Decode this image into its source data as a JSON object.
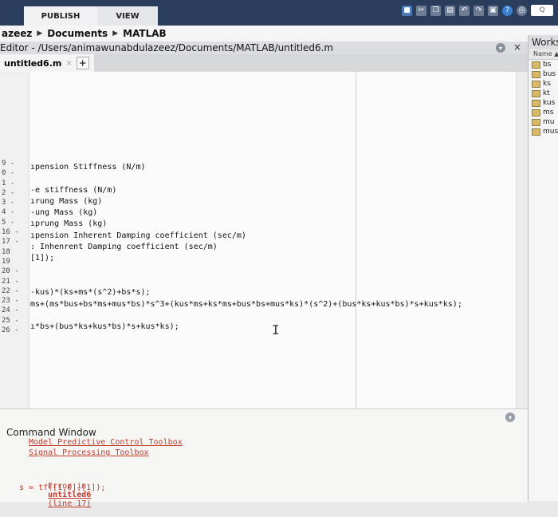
{
  "toolstrip": {
    "tabs": [
      "PUBLISH",
      "VIEW"
    ],
    "search_label": "Q"
  },
  "breadcrumb": [
    "azeez",
    "Documents",
    "MATLAB"
  ],
  "editor": {
    "title": "Editor - /Users/animawunabdulazeez/Documents/MATLAB/untitled6.m",
    "file_tab": "untitled6.m",
    "close_glyph": "×",
    "add_glyph": "+",
    "line_numbers": [
      "9 -",
      "0 -",
      "1 -",
      "2 -",
      "3 -",
      "4 -",
      "5 -",
      "16 -",
      "17 -",
      "18",
      "19",
      "20 -",
      "21 -",
      "22 -",
      "23 -",
      "24 -",
      "25 -",
      "26 -"
    ],
    "code_lines": [
      "ıpension Stiffness (N/m)",
      "",
      "-e stiffness (N/m)",
      "ırung Mass (kg)",
      "-ung Mass (kg)",
      "ıprung Mass (kg)",
      "ıpension Inherent Damping coefficient (sec/m)",
      ": Inhenrent Damping coefficient (sec/m)",
      "[1]);",
      "",
      "",
      "-kus)*(ks+ms*(s^2)+bs*s);",
      "ms+(ms*bus+bs*ms+mus*bs)*s^3+(kus*ms+ks*ms+bus*bs+mus*ks)*(s^2)+(bus*ks+kus*bs)*s+kus*ks);",
      "",
      "ı*bs+(bus*ks+kus*bs)*s+kus*ks);",
      "",
      "",
      ""
    ],
    "text_cursor": "I"
  },
  "command_window": {
    "title": "Command Window",
    "links": [
      "Model Predictive Control Toolbox",
      "Signal Processing Toolbox"
    ],
    "error_prefix": "Error in",
    "error_file": "untitled6",
    "error_line": "(line 17)",
    "error_code": "s = tf([1,0],[1]);"
  },
  "workspace": {
    "title": "Works",
    "column": "Name ▲",
    "variables": [
      "bs",
      "bus",
      "ks",
      "kt",
      "kus",
      "ms",
      "mu",
      "mus"
    ]
  }
}
